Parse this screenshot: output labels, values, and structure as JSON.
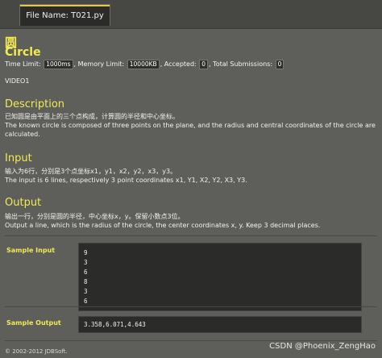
{
  "tab": {
    "label": "File Name:  T021.py"
  },
  "problem": {
    "title_cn": "圆",
    "title_en": "Circle",
    "limits": {
      "time_label": "Time Limit:",
      "time_value": "1000ms",
      "memory_label": ", Memory Limit:",
      "memory_value": "10000KB",
      "accepted_label": ", Accepted:",
      "accepted_value": "0",
      "submissions_label": ", Total Submissions:",
      "submissions_value": "0"
    },
    "video": "VIDEO1"
  },
  "description": {
    "heading": "Description",
    "text_cn": "已知圆是由平面上的三个点构成，计算圆的半径和中心坐标。",
    "text_en": "The known circle is composed of three points on the plane, and the radius and central coordinates of the circle are calculated."
  },
  "input": {
    "heading": "Input",
    "text_cn": "输入为6行，分别是3个点坐标x1，y1，x2，y2，x3，y3。",
    "text_en": "The input is 6 lines, respectively 3 point coordinates x1, Y1, X2, Y2, X3, Y3."
  },
  "output": {
    "heading": "Output",
    "text_cn": "输出一行，分别是圆的半径，中心坐标x，y。保留小数点3位。",
    "text_en": "Output a line, which is the radius of the circle, the center coordinates x, y. Keep 3 decimal places."
  },
  "sample_input": {
    "label": "Sample Input",
    "lines": [
      "9",
      "3",
      "6",
      "8",
      "3",
      "6"
    ]
  },
  "sample_output": {
    "label": "Sample Output",
    "lines": [
      "3.358,6.071,4.643"
    ]
  },
  "footer": "© 2002-2012  JDBSoft.",
  "watermark": "CSDN @Phoenix_ZengHao"
}
